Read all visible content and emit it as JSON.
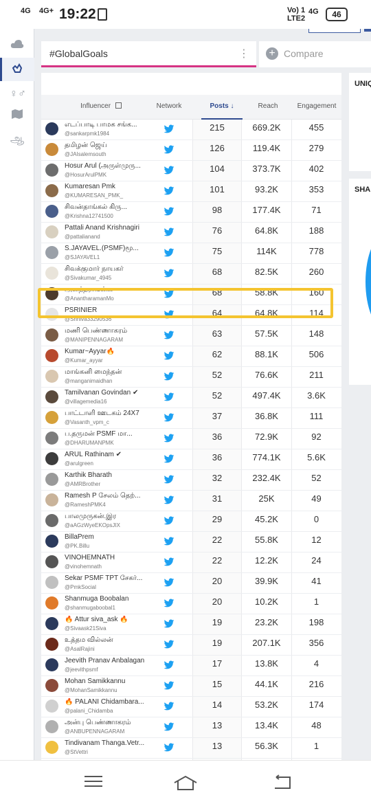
{
  "status_bar": {
    "signal1": "4G",
    "signal2": "4G+",
    "time": "19:22",
    "volte": "Vo) 1\nLTE2",
    "net2": "4G",
    "battery": "46"
  },
  "tabs": {
    "hashtag_label": "#GlobalGoals",
    "compare_label": "Compare"
  },
  "right_cards": {
    "card1_label": "UNIQ",
    "card2_label": "SHA"
  },
  "table": {
    "headers": {
      "influencer": "Influencer",
      "network": "Network",
      "posts": "Posts",
      "reach": "Reach",
      "engagement": "Engagement"
    },
    "rows": [
      {
        "name": "எடப்பாடி பாமக சங்க...",
        "handle": "@sankarpmk1984",
        "posts": "215",
        "reach": "669.2K",
        "engagement": "455"
      },
      {
        "name": "தமிழன் ஜெய்",
        "handle": "@JAIsalemsouth",
        "posts": "126",
        "reach": "119.4K",
        "engagement": "279"
      },
      {
        "name": "Hosur Arul (அருள்முரு...",
        "handle": "@HosurArulPMK",
        "posts": "104",
        "reach": "373.7K",
        "engagement": "402"
      },
      {
        "name": "Kumaresan Pmk",
        "handle": "@KUMARESAN_PMK_",
        "posts": "101",
        "reach": "93.2K",
        "engagement": "353"
      },
      {
        "name": "சிவன்தாங்கல் கிரு...",
        "handle": "@Krishna12741500",
        "posts": "98",
        "reach": "177.4K",
        "engagement": "71"
      },
      {
        "name": "Pattali Anand Krishnagiri",
        "handle": "@pattalianand",
        "posts": "76",
        "reach": "64.8K",
        "engagement": "188"
      },
      {
        "name": "S.JAYAVEL.(PSMF)மூ...",
        "handle": "@SJAYAVEL1",
        "posts": "75",
        "reach": "114K",
        "engagement": "778"
      },
      {
        "name": "சிவக்குமார் நாயகர்",
        "handle": "@Sivakumar_4945",
        "posts": "68",
        "reach": "82.5K",
        "engagement": "260"
      },
      {
        "name": "அனந்தராமன்...",
        "handle": "@AnantharamanMo",
        "posts": "68",
        "reach": "58.8K",
        "engagement": "160"
      },
      {
        "name": "PSRINIER",
        "handle": "@Sriniva33290536",
        "posts": "64",
        "reach": "64.8K",
        "engagement": "114"
      },
      {
        "name": "மணி பெண்ணாகரம்",
        "handle": "@MANIPENNAGARAM",
        "posts": "63",
        "reach": "57.5K",
        "engagement": "148"
      },
      {
        "name": "Kumar~Ayyar🔥",
        "handle": "@Kumar_ayyar",
        "posts": "62",
        "reach": "88.1K",
        "engagement": "506"
      },
      {
        "name": "மாங்கனி மைந்தன்",
        "handle": "@manganimaidhan",
        "posts": "52",
        "reach": "76.6K",
        "engagement": "211"
      },
      {
        "name": "Tamilvanan Govindan ✔",
        "handle": "@villagemedia16",
        "posts": "52",
        "reach": "497.4K",
        "engagement": "3.6K"
      },
      {
        "name": "பாட்டாளி ஊடகம் 24X7",
        "handle": "@Vasanth_vpm_c",
        "posts": "37",
        "reach": "36.8K",
        "engagement": "111"
      },
      {
        "name": "ப.தருமன் PSMF மா...",
        "handle": "@DHARUMANPMK",
        "posts": "36",
        "reach": "72.9K",
        "engagement": "92"
      },
      {
        "name": "ARUL Rathinam ✔",
        "handle": "@arulgreen",
        "posts": "36",
        "reach": "774.1K",
        "engagement": "5.6K"
      },
      {
        "name": "Karthik Bharath",
        "handle": "@AMRBrother",
        "posts": "32",
        "reach": "232.4K",
        "engagement": "52"
      },
      {
        "name": "Ramesh P சேலம் தெற்...",
        "handle": "@RameshPMK4",
        "posts": "31",
        "reach": "25K",
        "engagement": "49"
      },
      {
        "name": "பாலமுருகன்.இர",
        "handle": "@aAGzWyeEKOpsJIX",
        "posts": "29",
        "reach": "45.2K",
        "engagement": "0"
      },
      {
        "name": "BillaPrem",
        "handle": "@PK.Billu",
        "posts": "22",
        "reach": "55.8K",
        "engagement": "12"
      },
      {
        "name": "VINOHEMNATH",
        "handle": "@vinohemnath",
        "posts": "22",
        "reach": "12.2K",
        "engagement": "24"
      },
      {
        "name": "Sekar PSMF TPT சேகர்...",
        "handle": "@PmkSocial",
        "posts": "20",
        "reach": "39.9K",
        "engagement": "41"
      },
      {
        "name": "Shanmuga Boobalan",
        "handle": "@shanmugaboobal1",
        "posts": "20",
        "reach": "10.2K",
        "engagement": "1"
      },
      {
        "name": "🔥 Attur siva_ask 🔥",
        "handle": "@Sivaask21Siva",
        "posts": "19",
        "reach": "23.2K",
        "engagement": "198"
      },
      {
        "name": "உத்தம வில்லன்",
        "handle": "@AsalRajini",
        "posts": "19",
        "reach": "207.1K",
        "engagement": "356"
      },
      {
        "name": "Jeevith Pranav Anbalagan",
        "handle": "@jeevithpsmf",
        "posts": "17",
        "reach": "13.8K",
        "engagement": "4"
      },
      {
        "name": "Mohan Samikkannu",
        "handle": "@MohanSamikkannu",
        "posts": "15",
        "reach": "44.1K",
        "engagement": "216"
      },
      {
        "name": "🔥 PALANI Chidambara...",
        "handle": "@palani_Chidamba",
        "posts": "14",
        "reach": "53.2K",
        "engagement": "174"
      },
      {
        "name": "அன்பு பெண்ணாகரம்",
        "handle": "@ANBUPENNAGARAM",
        "posts": "13",
        "reach": "13.4K",
        "engagement": "48"
      },
      {
        "name": "Tindivanam Thanga.Vetr...",
        "handle": "@StVettri",
        "posts": "13",
        "reach": "56.3K",
        "engagement": "1"
      }
    ]
  },
  "colors": {
    "accent": "#2e4a8f",
    "tab_underline": "#d63384",
    "twitter": "#1da1f2",
    "highlight": "#f4c430"
  },
  "icons": {
    "sidebar": [
      "cloud-icon",
      "hand-icon",
      "gender-icon",
      "map-icon",
      "tamil-script-icon"
    ],
    "nav": [
      "menu-icon",
      "home-icon",
      "back-icon"
    ]
  }
}
